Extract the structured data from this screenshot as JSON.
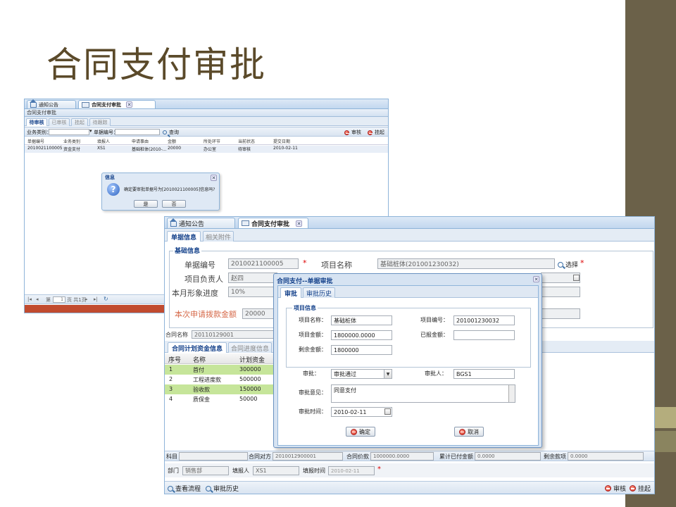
{
  "slide_title": "合同支付审批",
  "win1": {
    "tabs": [
      "通知公告",
      "合同支付审批"
    ],
    "panel_title": "合同支付审批",
    "subtabs": [
      "待审核",
      "已审核",
      "挂起",
      "待跟踪"
    ],
    "filter": {
      "type_label": "业务类别：",
      "no_label": "单据编号：",
      "search_label": "查询",
      "approve_label": "审核",
      "suspend_label": "挂起"
    },
    "grid": {
      "headers": [
        "单据编号",
        "业务类别",
        "填报人",
        "申请事由",
        "金额",
        "所处环节",
        "当前状态",
        "提交日期"
      ],
      "rows": [
        [
          "2010021100005",
          "资金支付",
          "XS1",
          "基础桩体(2010-...",
          "20000",
          "办公室",
          "待审核",
          "2010-02-11"
        ]
      ]
    },
    "pager": {
      "page_label": "第",
      "page_value": "1",
      "total_label": "页 共1页"
    },
    "dialog": {
      "title": "信息",
      "message": "确定要审批单据号为[2010021100005]信息吗?",
      "yes": "是",
      "no": "否"
    }
  },
  "win2": {
    "tabs": [
      "通知公告",
      "合同支付审批"
    ],
    "subtabs": [
      "单据信息",
      "相关附件"
    ],
    "section_title": "基础信息",
    "fields": {
      "doc_no_label": "单据编号",
      "doc_no": "2010021100005",
      "project_name_label": "项目名称",
      "project_name": "基础桩体(201001230032)",
      "select_label": "选择",
      "manager_label": "项目负责人",
      "manager": "赵四",
      "progress_label": "本月形象进度",
      "progress": "10%",
      "apply_label": "本次申请拨款金额",
      "apply": "20000",
      "contract_label": "合同名称",
      "contract": "20110129001"
    },
    "grid_tabs": [
      "合同计划资金信息",
      "合同进度信息"
    ],
    "grid": {
      "headers": [
        "序号",
        "名称",
        "计划资金"
      ],
      "rows": [
        [
          "1",
          "首付",
          "300000"
        ],
        [
          "2",
          "工程进度款",
          "500000"
        ],
        [
          "3",
          "验收款",
          "150000"
        ],
        [
          "4",
          "质保金",
          "50000"
        ]
      ]
    },
    "summary": {
      "subject_label": "科目",
      "party_label": "合同对方",
      "party": "2010012900001",
      "price_label": "合同价款",
      "price": "1000000.0000",
      "paid_label": "累计已付金额",
      "paid": "0.0000",
      "rest_label": "剩余款项",
      "rest": "0.0000"
    },
    "footer": {
      "dept_label": "部门",
      "dept": "销售部",
      "filler_label": "填报人",
      "filler": "XS1",
      "date_label": "填报时间",
      "date": "2010-02-11"
    },
    "bottom": {
      "flow_label": "查看流程",
      "history_label": "审批历史",
      "approve_label": "审核",
      "suspend_label": "挂起"
    }
  },
  "modal": {
    "title": "合同支付--单据审批",
    "tabs": [
      "审批",
      "审批历史"
    ],
    "section_title": "项目信息",
    "project_name_label": "项目名称：",
    "project_name": "基础桩体",
    "project_no_label": "项目编号：",
    "project_no": "201001230032",
    "amount_label": "项目金额：",
    "amount": "1800000.0000",
    "reported_label": "已报金额：",
    "reported": "",
    "remaining_label": "剩余金额：",
    "remaining": "1800000",
    "approval_label": "审批：",
    "approval": "审批通过",
    "approver_label": "审批人：",
    "approver": "BGS1",
    "opinion_label": "审批意见：",
    "opinion": "同意支付",
    "time_label": "审批时间：",
    "time": "2010-02-11",
    "ok": "确定",
    "cancel": "取消"
  },
  "colors": {
    "accent": "#15428b",
    "row_highlight": "#c6e59a",
    "slide_band": "#6b6149",
    "title": "#5b4a2a"
  }
}
